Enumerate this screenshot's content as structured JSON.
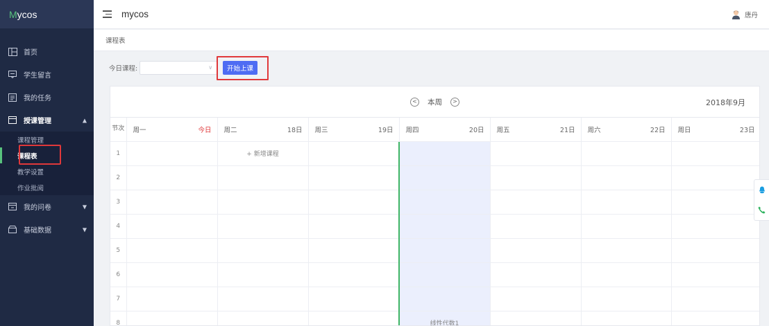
{
  "app": {
    "logo_m": "M",
    "logo_rest": "ycos",
    "name": "mycos"
  },
  "user": {
    "name": "唐丹"
  },
  "sidebar": {
    "items": [
      {
        "label": "首页",
        "icon": "home-icon"
      },
      {
        "label": "学生留言",
        "icon": "message-icon"
      },
      {
        "label": "我的任务",
        "icon": "task-icon"
      },
      {
        "label": "授课管理",
        "icon": "teaching-icon",
        "expanded": true,
        "children": [
          {
            "label": "课程管理"
          },
          {
            "label": "课程表",
            "active": true
          },
          {
            "label": "教学设置"
          },
          {
            "label": "作业批阅"
          }
        ]
      },
      {
        "label": "我的问卷",
        "icon": "survey-icon"
      },
      {
        "label": "基础数据",
        "icon": "data-icon"
      }
    ]
  },
  "breadcrumb": {
    "current": "课程表"
  },
  "toolbar": {
    "today_course_label": "今日课程:",
    "select_value": "",
    "start_button": "开始上课"
  },
  "calendar": {
    "prev_label": "<",
    "week_label": "本周",
    "next_label": ">",
    "month": "2018年9月",
    "index_header": "节次",
    "days": [
      {
        "name": "周一",
        "date": "今日",
        "today_marker": true
      },
      {
        "name": "周二",
        "date": "18日"
      },
      {
        "name": "周三",
        "date": "19日"
      },
      {
        "name": "周四",
        "date": "20日"
      },
      {
        "name": "周五",
        "date": "21日"
      },
      {
        "name": "周六",
        "date": "22日"
      },
      {
        "name": "周日",
        "date": "23日"
      }
    ],
    "periods": [
      "1",
      "2",
      "3",
      "4",
      "5",
      "6",
      "7",
      "8"
    ],
    "add_course_label": "+ 新增课程",
    "course_cell_text": "线性代数1",
    "highlight_color": "#ebeffd",
    "today_line_color": "#3fb566"
  },
  "colors": {
    "sidebar_bg": "#1f2a44",
    "primary": "#4e6cf3",
    "annotation_red": "#e0383a",
    "accent_green": "#58c27d"
  }
}
